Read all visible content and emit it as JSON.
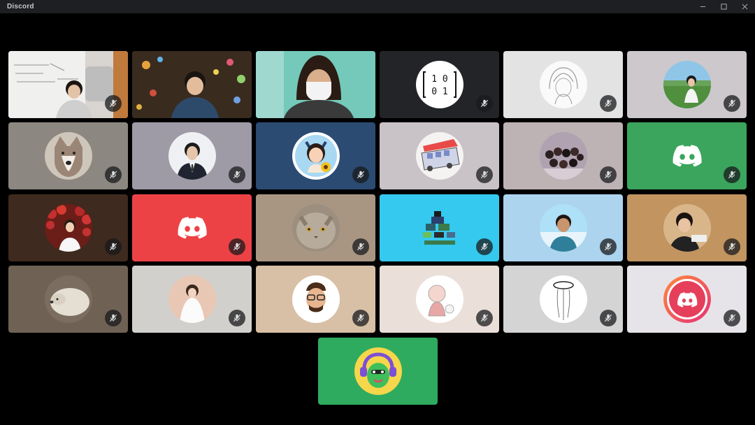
{
  "window": {
    "title": "Discord"
  },
  "colors": {
    "titlebar": "#1e1f22",
    "mute_bg": "#18191c",
    "discord_green": "#3ba55d",
    "discord_red": "#ed4245"
  },
  "participants": [
    {
      "type": "video",
      "bg": "#c9c4be",
      "muted": true
    },
    {
      "type": "video",
      "bg": "#4e3b2a",
      "muted": false
    },
    {
      "type": "video",
      "bg": "#5fb9aa",
      "muted": false
    },
    {
      "type": "avatar",
      "bg": "#232428",
      "avatar": "matrix",
      "matrix_text": [
        "1 0",
        "0 1"
      ],
      "muted": true
    },
    {
      "type": "avatar",
      "bg": "#e3e3e3",
      "avatar": "sketch-girl",
      "muted": true
    },
    {
      "type": "avatar",
      "bg": "#ccc8cc",
      "avatar": "person-landscape",
      "muted": true
    },
    {
      "type": "avatar",
      "bg": "#8c8780",
      "avatar": "wolf",
      "muted": true
    },
    {
      "type": "avatar",
      "bg": "#9e9aa6",
      "avatar": "person-suit",
      "muted": true
    },
    {
      "type": "avatar",
      "bg": "#2b4b72",
      "avatar": "cartoon-girl",
      "muted": true
    },
    {
      "type": "avatar",
      "bg": "#c9c2c7",
      "avatar": "bus-drawing",
      "muted": true
    },
    {
      "type": "avatar",
      "bg": "#bdb2b4",
      "avatar": "group-photo",
      "muted": true
    },
    {
      "type": "discord",
      "bg": "#3ba55d",
      "muted": true
    },
    {
      "type": "avatar",
      "bg": "#3e2a1e",
      "avatar": "strawberry-person",
      "muted": true
    },
    {
      "type": "discord",
      "bg": "#ed4245",
      "muted": true
    },
    {
      "type": "avatar",
      "bg": "#a99682",
      "avatar": "cat",
      "muted": true
    },
    {
      "type": "avatar",
      "bg": "#35c9ef",
      "avatar": "pixel-art",
      "muted": true
    },
    {
      "type": "avatar",
      "bg": "#acd4ef",
      "avatar": "person-smile",
      "muted": true
    },
    {
      "type": "avatar",
      "bg": "#c19460",
      "avatar": "kid",
      "muted": true
    },
    {
      "type": "avatar",
      "bg": "#6f6255",
      "avatar": "dog",
      "muted": true
    },
    {
      "type": "avatar",
      "bg": "#d1d0cc",
      "avatar": "woman-white",
      "muted": true
    },
    {
      "type": "avatar",
      "bg": "#d8c0a6",
      "avatar": "memoji",
      "muted": true
    },
    {
      "type": "avatar",
      "bg": "#ebdfd9",
      "avatar": "sketch-baby",
      "muted": true
    },
    {
      "type": "avatar",
      "bg": "#d4d4d4",
      "avatar": "ring-drawing",
      "muted": true
    },
    {
      "type": "avatar",
      "bg": "#e6e4e8",
      "avatar": "discord-gradient",
      "muted": true
    },
    {
      "type": "avatar",
      "bg": "#2fab5f",
      "avatar": "green-mascot",
      "muted": false
    }
  ]
}
